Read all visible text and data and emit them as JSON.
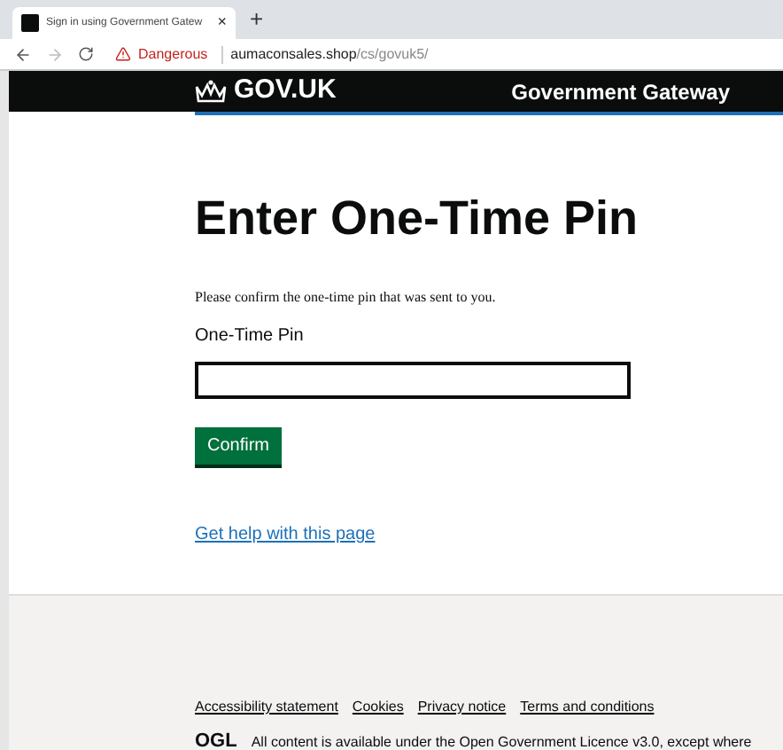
{
  "browser": {
    "tab_title": "Sign in using Government Gatew",
    "tab_close": "×",
    "new_tab": "+",
    "security_label": "Dangerous",
    "url_host": "aumaconsales.shop",
    "url_path": "/cs/govuk5/"
  },
  "header": {
    "logo_text": "GOV.UK",
    "service_name": "Government Gateway"
  },
  "main": {
    "heading": "Enter One-Time Pin",
    "intro": "Please confirm the one-time pin that was sent to you.",
    "field_label": "One-Time Pin",
    "button": "Confirm",
    "help_link": "Get help with this page"
  },
  "footer": {
    "links": [
      "Accessibility statement",
      "Cookies",
      "Privacy notice",
      "Terms and conditions"
    ],
    "ogl_logo": "OGL",
    "licence_text": "All content is available under the Open Government Licence v3.0, except where"
  }
}
